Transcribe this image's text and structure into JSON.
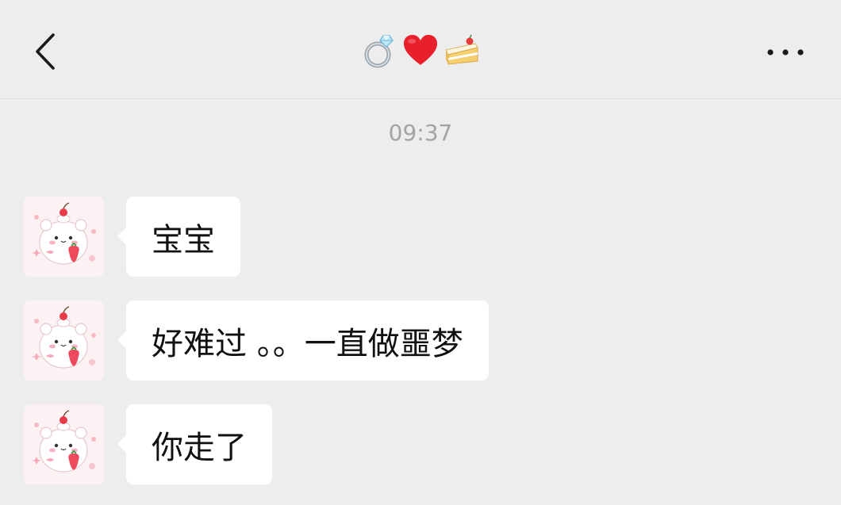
{
  "header": {
    "back_icon": "chevron-left-icon",
    "title_emojis": [
      "ring-emoji",
      "red-heart-emoji",
      "cake-slice-emoji"
    ],
    "more_icon": "ellipsis-icon"
  },
  "timestamp": "09:37",
  "messages": [
    {
      "text": "宝宝",
      "avatar": "hamster-strawberry-avatar"
    },
    {
      "text": "好难过 。。一直做噩梦",
      "avatar": "hamster-strawberry-avatar"
    },
    {
      "text": "你走了",
      "avatar": "hamster-strawberry-avatar"
    }
  ],
  "colors": {
    "background": "#ededed",
    "bubble": "#ffffff",
    "timestamp": "#a3a3a3",
    "heart": "#e8202c"
  }
}
